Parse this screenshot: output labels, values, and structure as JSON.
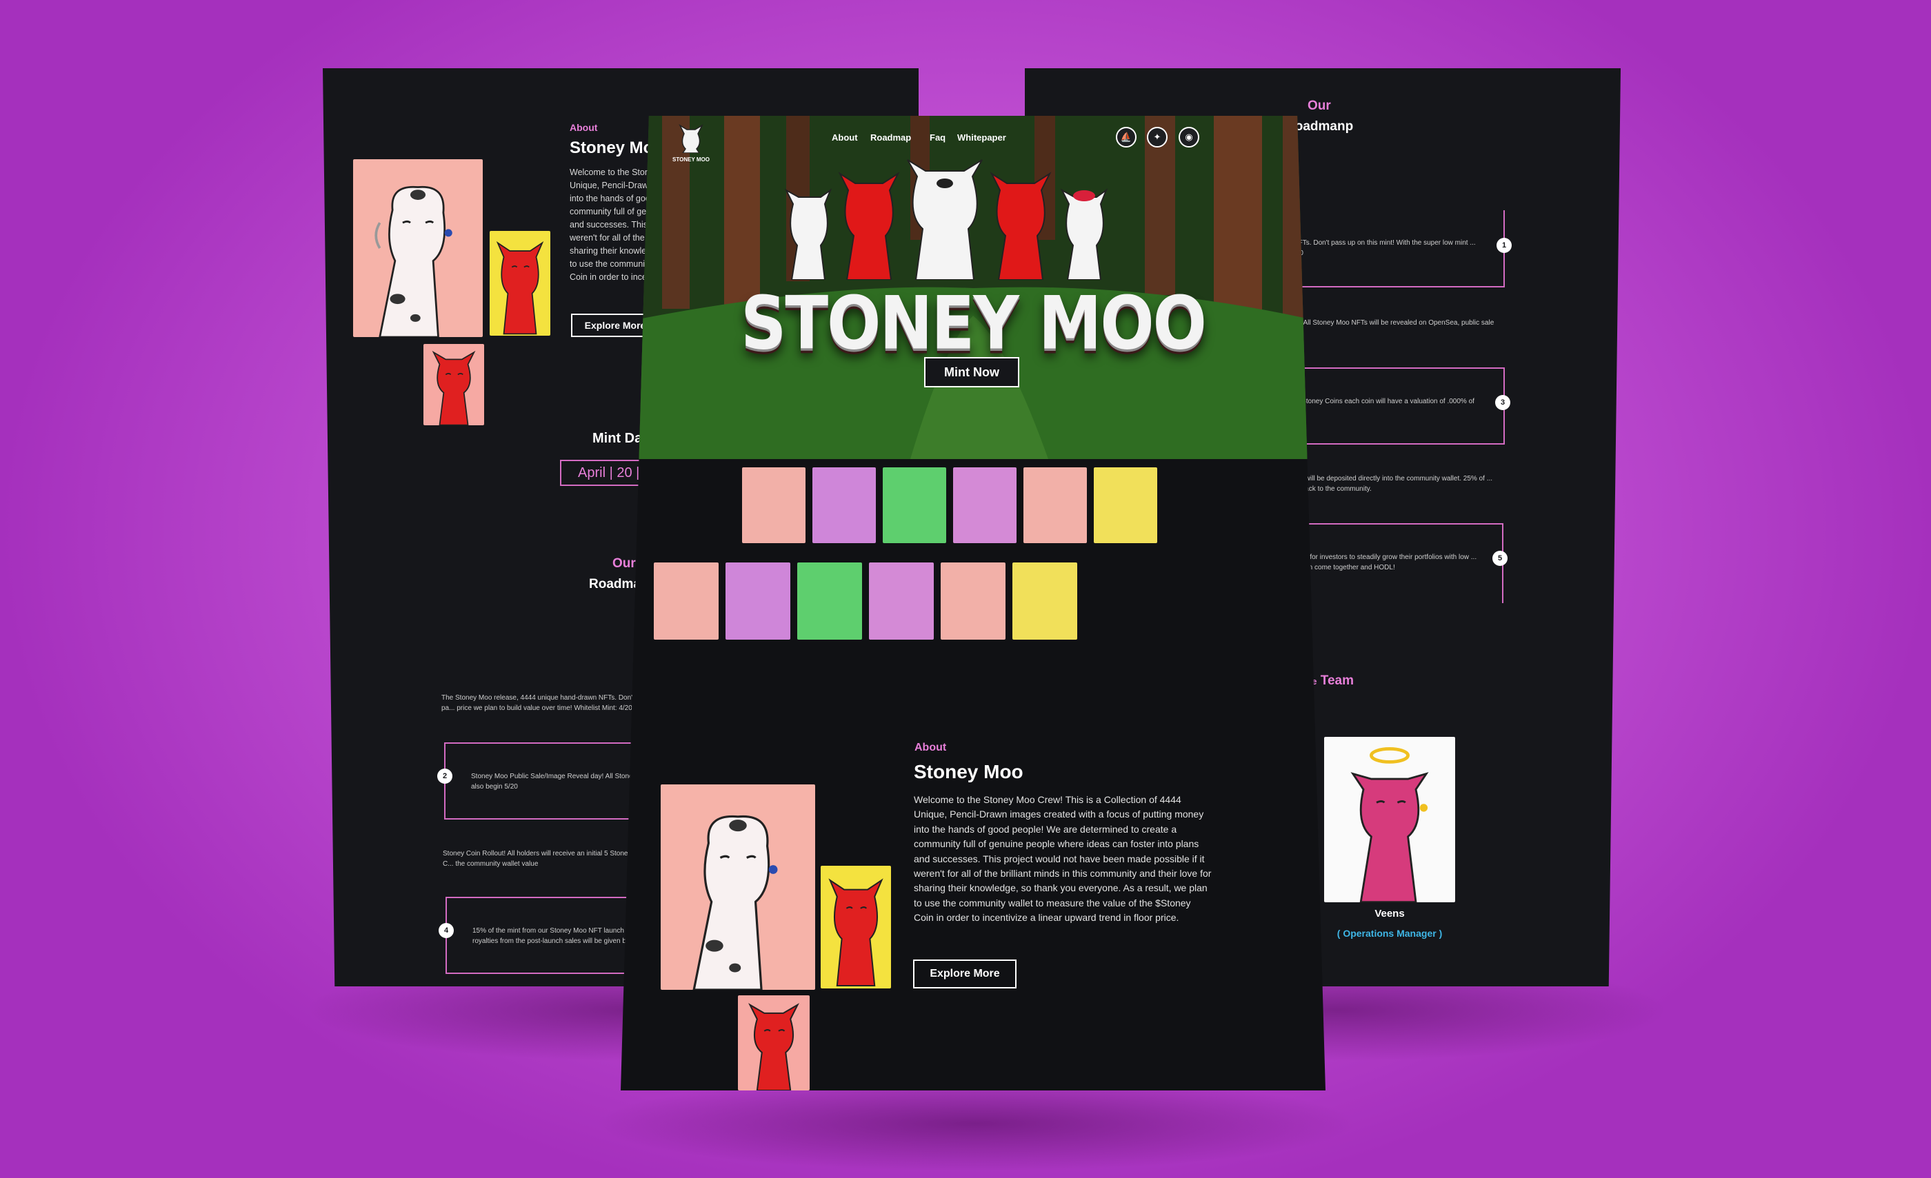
{
  "left_page": {
    "about_label": "About",
    "about_title": "Stoney Moo",
    "about_text": "Welcome to the Stoney M... Unique, Pencil-Drawn ima... into the hands of good pe... community full of genuin... and successes. This proj... weren't for all of the brilli... sharing their knowledge... to use the community w... Coin in order to incentivi...",
    "about_lines": [
      "Welcome to the Stoney M",
      "Unique, Pencil-Drawn ima",
      "into the hands of good pe",
      "community full of genuin",
      "and successes. This proj",
      "weren't for all of the brilli",
      "sharing their knowledge",
      "to use the community w",
      "Coin in order to incentivi"
    ],
    "explore_button": "Explore More",
    "mint_date_title": "Mint Date",
    "mint_date_value": "April | 20 | 20",
    "roadmap_our": "Our",
    "roadmap_title": "Roadmar",
    "roadmap_items": [
      {
        "text": "The Stoney Moo release, 4444 unique hand-drawn NFTs. Don't pa... price we plan to build value over time! Whitelist Mint: 4/20"
      },
      {
        "num": "2",
        "text": "Stoney Moo Public Sale/Image Reveal day! All Stoney M... also begin 5/20"
      },
      {
        "text": "Stoney Coin Rollout! All holders will receive an initial 5 Stoney C... the community wallet value"
      },
      {
        "num": "4",
        "text": "15% of the mint from our Stoney Moo NFT launch will... royalties from the post-launch sales will be given ba..."
      }
    ]
  },
  "right_page": {
    "roadmap_our": "Our",
    "roadmap_title": "Roadmanp",
    "roadmap_items": [
      {
        "num": "1",
        "text": "...awn NFTs. Don't pass up on this mint! With the super low mint ... Mint: 4/20"
      },
      {
        "text": "...day! All Stoney Moo NFTs will be revealed on OpenSea, public sale will"
      },
      {
        "num": "3",
        "text": "...al 5 Stoney Coins each coin will have a valuation of .000% of"
      },
      {
        "text": "...unch will be deposited directly into the community wallet. 25% of ... given back to the community."
      },
      {
        "num": "5",
        "text": "...list for investors to steadily grow their portfolios with low ... at can come together and HODL!"
      }
    ],
    "team_prefix": "the",
    "team_title": "Team",
    "member_name": "Veens",
    "member_role": "( Operations Manager )"
  },
  "center_page": {
    "logo_text": "STONEY MOO",
    "nav": [
      "About",
      "Roadmap",
      "Faq",
      "Whitepaper"
    ],
    "socials": [
      "opensea-icon",
      "twitter-icon",
      "discord-icon"
    ],
    "hero_title": "STONEY MOO",
    "mint_button": "Mint Now",
    "gallery_row1": [
      "#f2b0a8",
      "#cf86d9",
      "#5ecf6e",
      "#d48ad6",
      "#f2b0a8",
      "#f1e05a"
    ],
    "gallery_row2": [
      "#f2b0a8",
      "#cf86d9",
      "#5ecf6e",
      "#d48ad6",
      "#f2b0a8",
      "#f1e05a"
    ],
    "about_label": "About",
    "about_title": "Stoney Moo",
    "about_lines": [
      "Welcome to the Stoney Moo Crew! This is a Collection of 4444",
      "Unique, Pencil-Drawn images created with a focus of putting money",
      "into the hands of good people! We are determined to create a",
      "community full of genuine people where ideas can foster into plans",
      "and successes. This project would not have been made possible if it",
      "weren't for all of the brilliant minds in this community and their love for",
      "sharing their knowledge, so thank you everyone. As a result, we plan",
      "to use the community wallet to measure the value of the $Stoney",
      "Coin in order to incentivize a linear upward trend in floor price."
    ],
    "explore_button": "Explore More"
  },
  "colors": {
    "background": "#c555d6",
    "page_bg": "#15161a",
    "accent_pink": "#e77fd9",
    "roadmap_border": "#d36bc2",
    "role_blue": "#3fb6e6"
  }
}
